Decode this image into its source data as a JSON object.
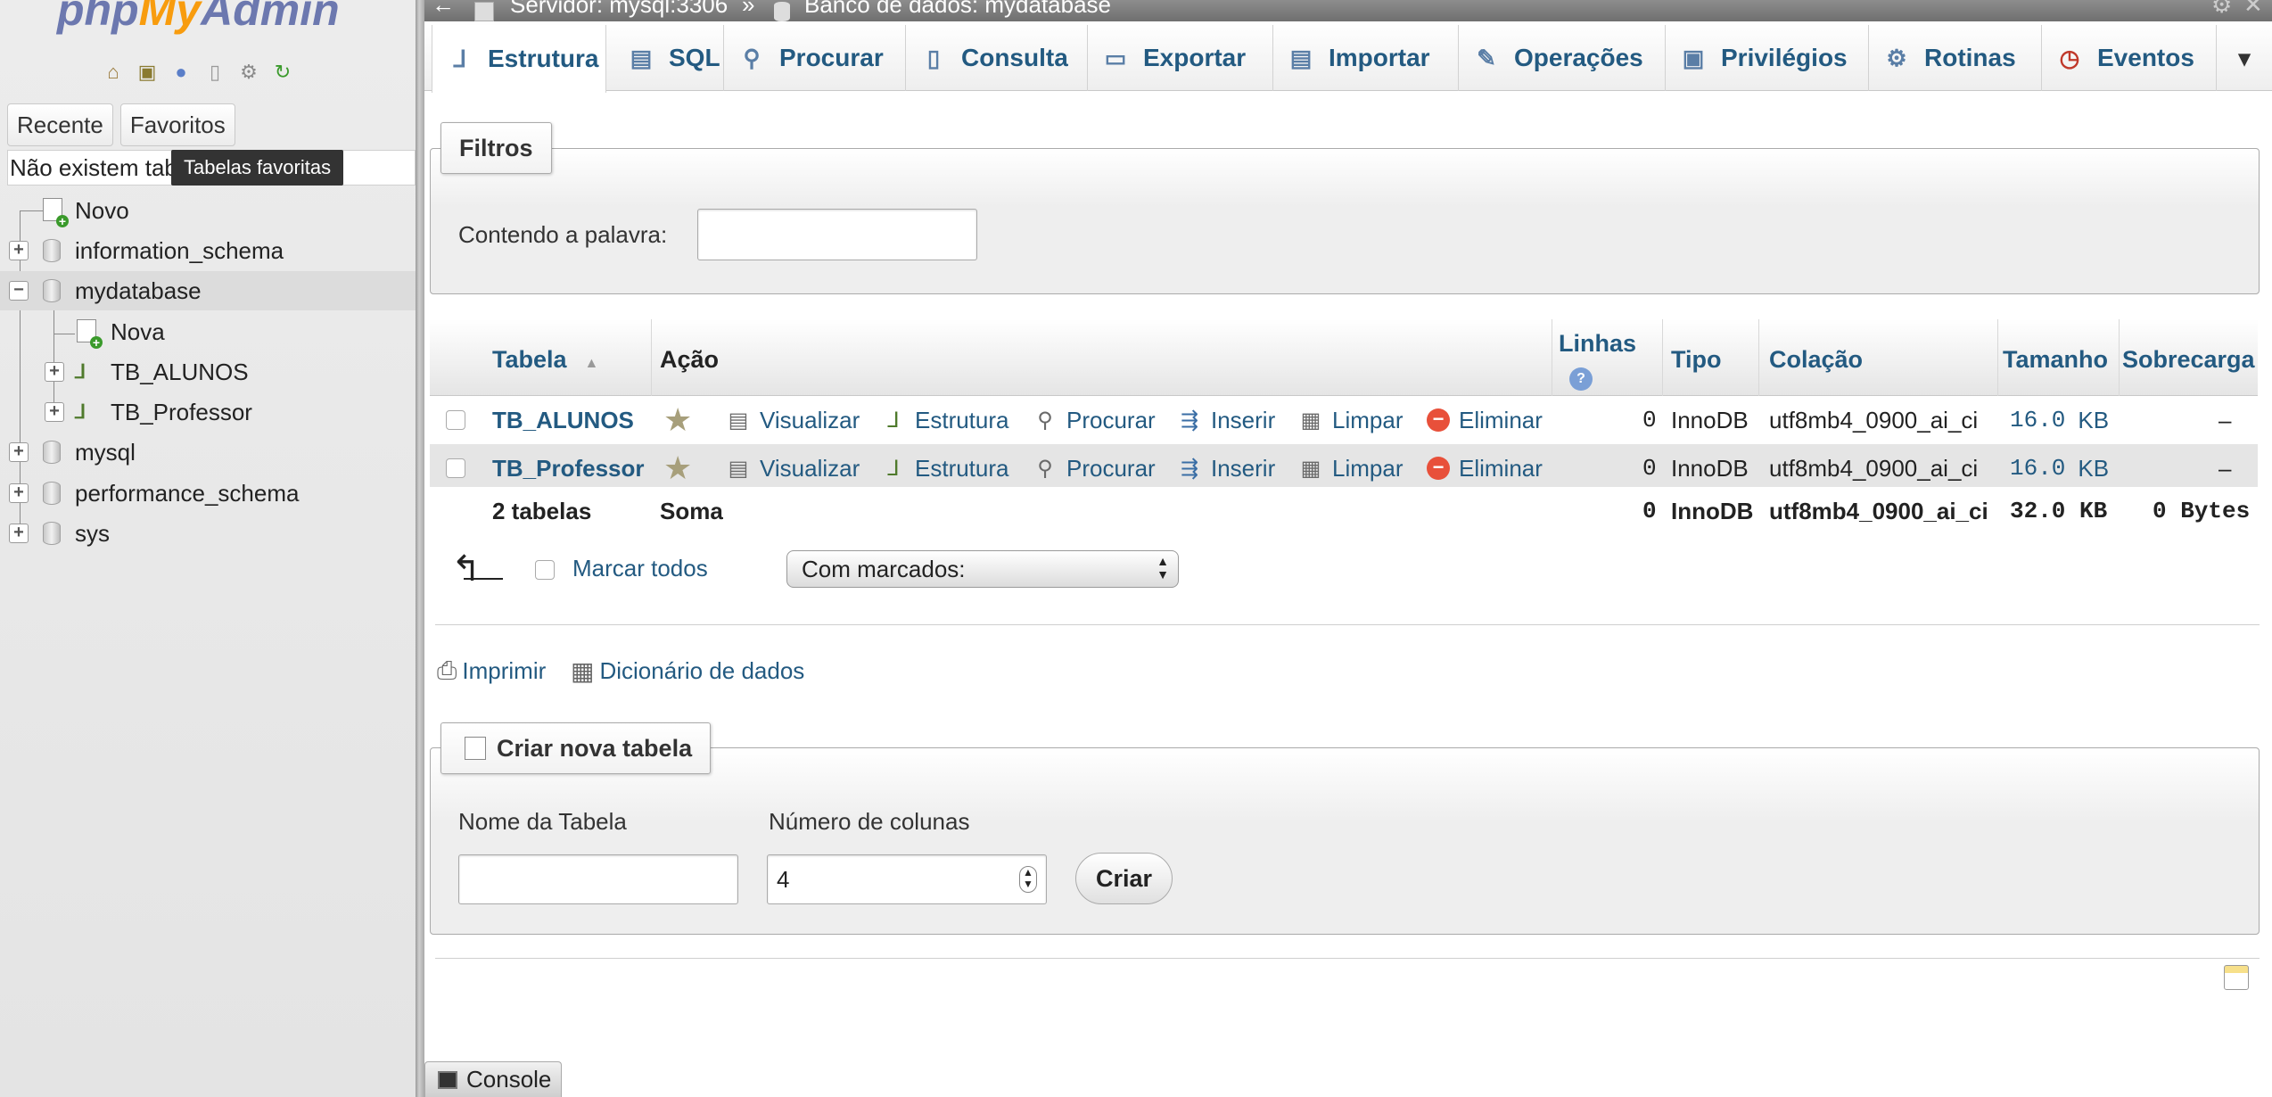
{
  "app": {
    "logo_php": "php",
    "logo_my": "My",
    "logo_admin": "Admin"
  },
  "nav": {
    "icons": [
      "home-icon",
      "exit-icon",
      "help-icon",
      "docs-icon",
      "settings-icon",
      "reload-icon"
    ],
    "tabs": [
      "Recente",
      "Favoritos"
    ],
    "favorites_empty": "Não existem tab",
    "tooltip": "Tabelas favoritas",
    "tree": {
      "new": "Novo",
      "information_schema": "information_schema",
      "mydatabase": "mydatabase",
      "new_table": "Nova",
      "tb_alunos": "TB_ALUNOS",
      "tb_professor": "TB_Professor",
      "mysql": "mysql",
      "performance_schema": "performance_schema",
      "sys": "sys"
    }
  },
  "breadcrumb": {
    "server": "Servidor: mysql:3306",
    "sep": "»",
    "database": "Banco de dados: mydatabase"
  },
  "menu_tabs": [
    "Estrutura",
    "SQL",
    "Procurar",
    "Consulta",
    "Exportar",
    "Importar",
    "Operações",
    "Privilégios",
    "Rotinas",
    "Eventos"
  ],
  "filters": {
    "legend": "Filtros",
    "label": "Contendo a palavra:",
    "value": ""
  },
  "table": {
    "headers": {
      "table": "Tabela",
      "action": "Ação",
      "rows": "Linhas",
      "type": "Tipo",
      "collation": "Colação",
      "size": "Tamanho",
      "overhead": "Sobrecarga"
    },
    "actions": [
      "Visualizar",
      "Estrutura",
      "Procurar",
      "Inserir",
      "Limpar",
      "Eliminar"
    ],
    "rows": [
      {
        "name": "TB_ALUNOS",
        "rows": "0",
        "type": "InnoDB",
        "collation": "utf8mb4_0900_ai_ci",
        "size": "16.0",
        "unit": "KB",
        "overhead": "–"
      },
      {
        "name": "TB_Professor",
        "rows": "0",
        "type": "InnoDB",
        "collation": "utf8mb4_0900_ai_ci",
        "size": "16.0",
        "unit": "KB",
        "overhead": "–"
      }
    ],
    "summary": {
      "count": "2 tabelas",
      "label": "Soma",
      "rows": "0",
      "type": "InnoDB",
      "collation": "utf8mb4_0900_ai_ci",
      "size": "32.0 KB",
      "overhead": "0 Bytes"
    }
  },
  "bulk": {
    "check_all": "Marcar todos",
    "with_selected": "Com marcados:"
  },
  "links": {
    "print": "Imprimir",
    "dictionary": "Dicionário de dados"
  },
  "create_table": {
    "legend": "Criar nova tabela",
    "name_label": "Nome da Tabela",
    "name_value": "",
    "columns_label": "Número de colunas",
    "columns_value": "4",
    "button": "Criar"
  },
  "console": {
    "label": "Console"
  }
}
